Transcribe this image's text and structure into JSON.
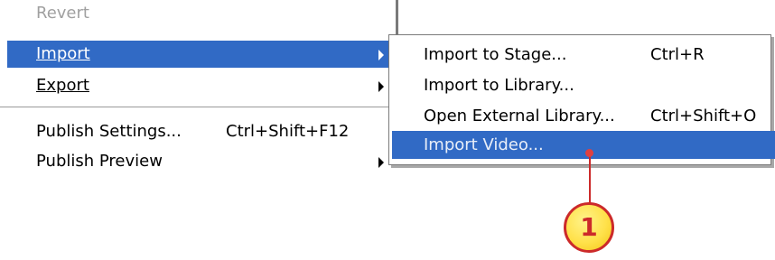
{
  "main_menu": {
    "items": [
      {
        "label": "Revert",
        "state": "disabled"
      },
      {
        "label": "Import",
        "underline_char": "I",
        "state": "active",
        "submenu": true
      },
      {
        "label": "Export",
        "underline_char": "E",
        "submenu": true
      },
      {
        "label": "Publish Settings...",
        "shortcut": "Ctrl+Shift+F12"
      },
      {
        "label": "Publish Preview",
        "submenu": true
      }
    ]
  },
  "import_submenu": {
    "items": [
      {
        "label": "Import to Stage...",
        "shortcut": "Ctrl+R"
      },
      {
        "label": "Import to Library..."
      },
      {
        "label": "Open External Library...",
        "shortcut": "Ctrl+Shift+O"
      },
      {
        "label": "Import Video...",
        "state": "active"
      }
    ]
  },
  "callout": {
    "number": "1",
    "color": "#cc2a2a",
    "fill": "#ffe14a"
  },
  "colors": {
    "highlight": "#316ac5",
    "disabled_text": "#a0a0a0"
  }
}
